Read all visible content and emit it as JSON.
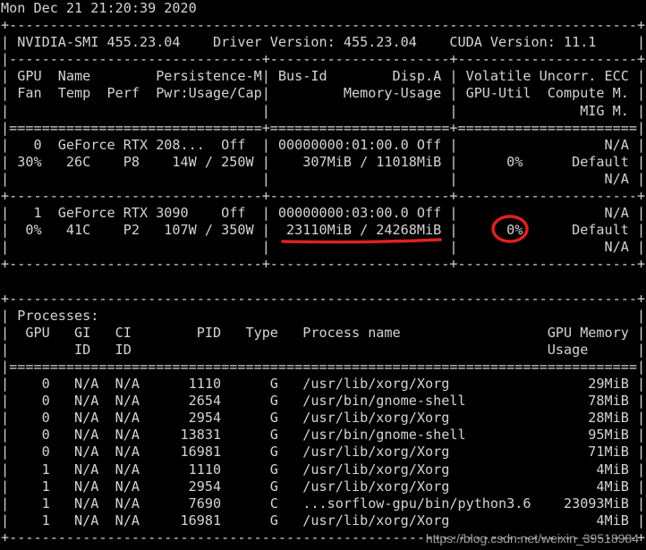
{
  "terminal": {
    "lines": [
      "Mon Dec 21 21:20:39 2020",
      "+-----------------------------------------------------------------------------+",
      "| NVIDIA-SMI 455.23.04    Driver Version: 455.23.04    CUDA Version: 11.1     |",
      "|-------------------------------+----------------------+----------------------+",
      "| GPU  Name        Persistence-M| Bus-Id        Disp.A | Volatile Uncorr. ECC |",
      "| Fan  Temp  Perf  Pwr:Usage/Cap|         Memory-Usage | GPU-Util  Compute M. |",
      "|                               |                      |               MIG M. |",
      "|===============================+======================+======================|",
      "|   0  GeForce RTX 208...  Off  | 00000000:01:00.0 Off |                  N/A |",
      "| 30%   26C    P8    14W / 250W |    307MiB / 11018MiB |      0%      Default |",
      "|                               |                      |                  N/A |",
      "+-------------------------------+----------------------+----------------------+",
      "|   1  GeForce RTX 3090    Off  | 00000000:03:00.0 Off |                  N/A |",
      "|  0%   41C    P2   107W / 350W |  23110MiB / 24268MiB |      0%      Default |",
      "|                               |                      |                  N/A |",
      "+-------------------------------+----------------------+----------------------+",
      "",
      "+-----------------------------------------------------------------------------+",
      "| Processes:                                                                  |",
      "|  GPU   GI   CI        PID   Type   Process name                  GPU Memory |",
      "|        ID   ID                                                   Usage      |",
      "|=============================================================================|",
      "|    0   N/A  N/A      1110      G   /usr/lib/xorg/Xorg                 29MiB |",
      "|    0   N/A  N/A      2654      G   /usr/bin/gnome-shell               78MiB |",
      "|    0   N/A  N/A      2954      G   /usr/lib/xorg/Xorg                 28MiB |",
      "|    0   N/A  N/A     13831      G   /usr/bin/gnome-shell               95MiB |",
      "|    0   N/A  N/A     16981      G   /usr/lib/xorg/Xorg                 71MiB |",
      "|    1   N/A  N/A      1110      G   /usr/lib/xorg/Xorg                  4MiB |",
      "|    1   N/A  N/A      2954      G   /usr/lib/xorg/Xorg                  4MiB |",
      "|    1   N/A  N/A      7690      C   ...sorflow-gpu/bin/python3.6    23093MiB |",
      "|    1   N/A  N/A     16981      G   /usr/lib/xorg/Xorg                  4MiB |",
      "+-----------------------------------------------------------------------------+"
    ]
  },
  "annotations": {
    "color": "#e02020"
  },
  "watermark": {
    "text": "https://blog.csdn.net/weixin_39518984"
  }
}
